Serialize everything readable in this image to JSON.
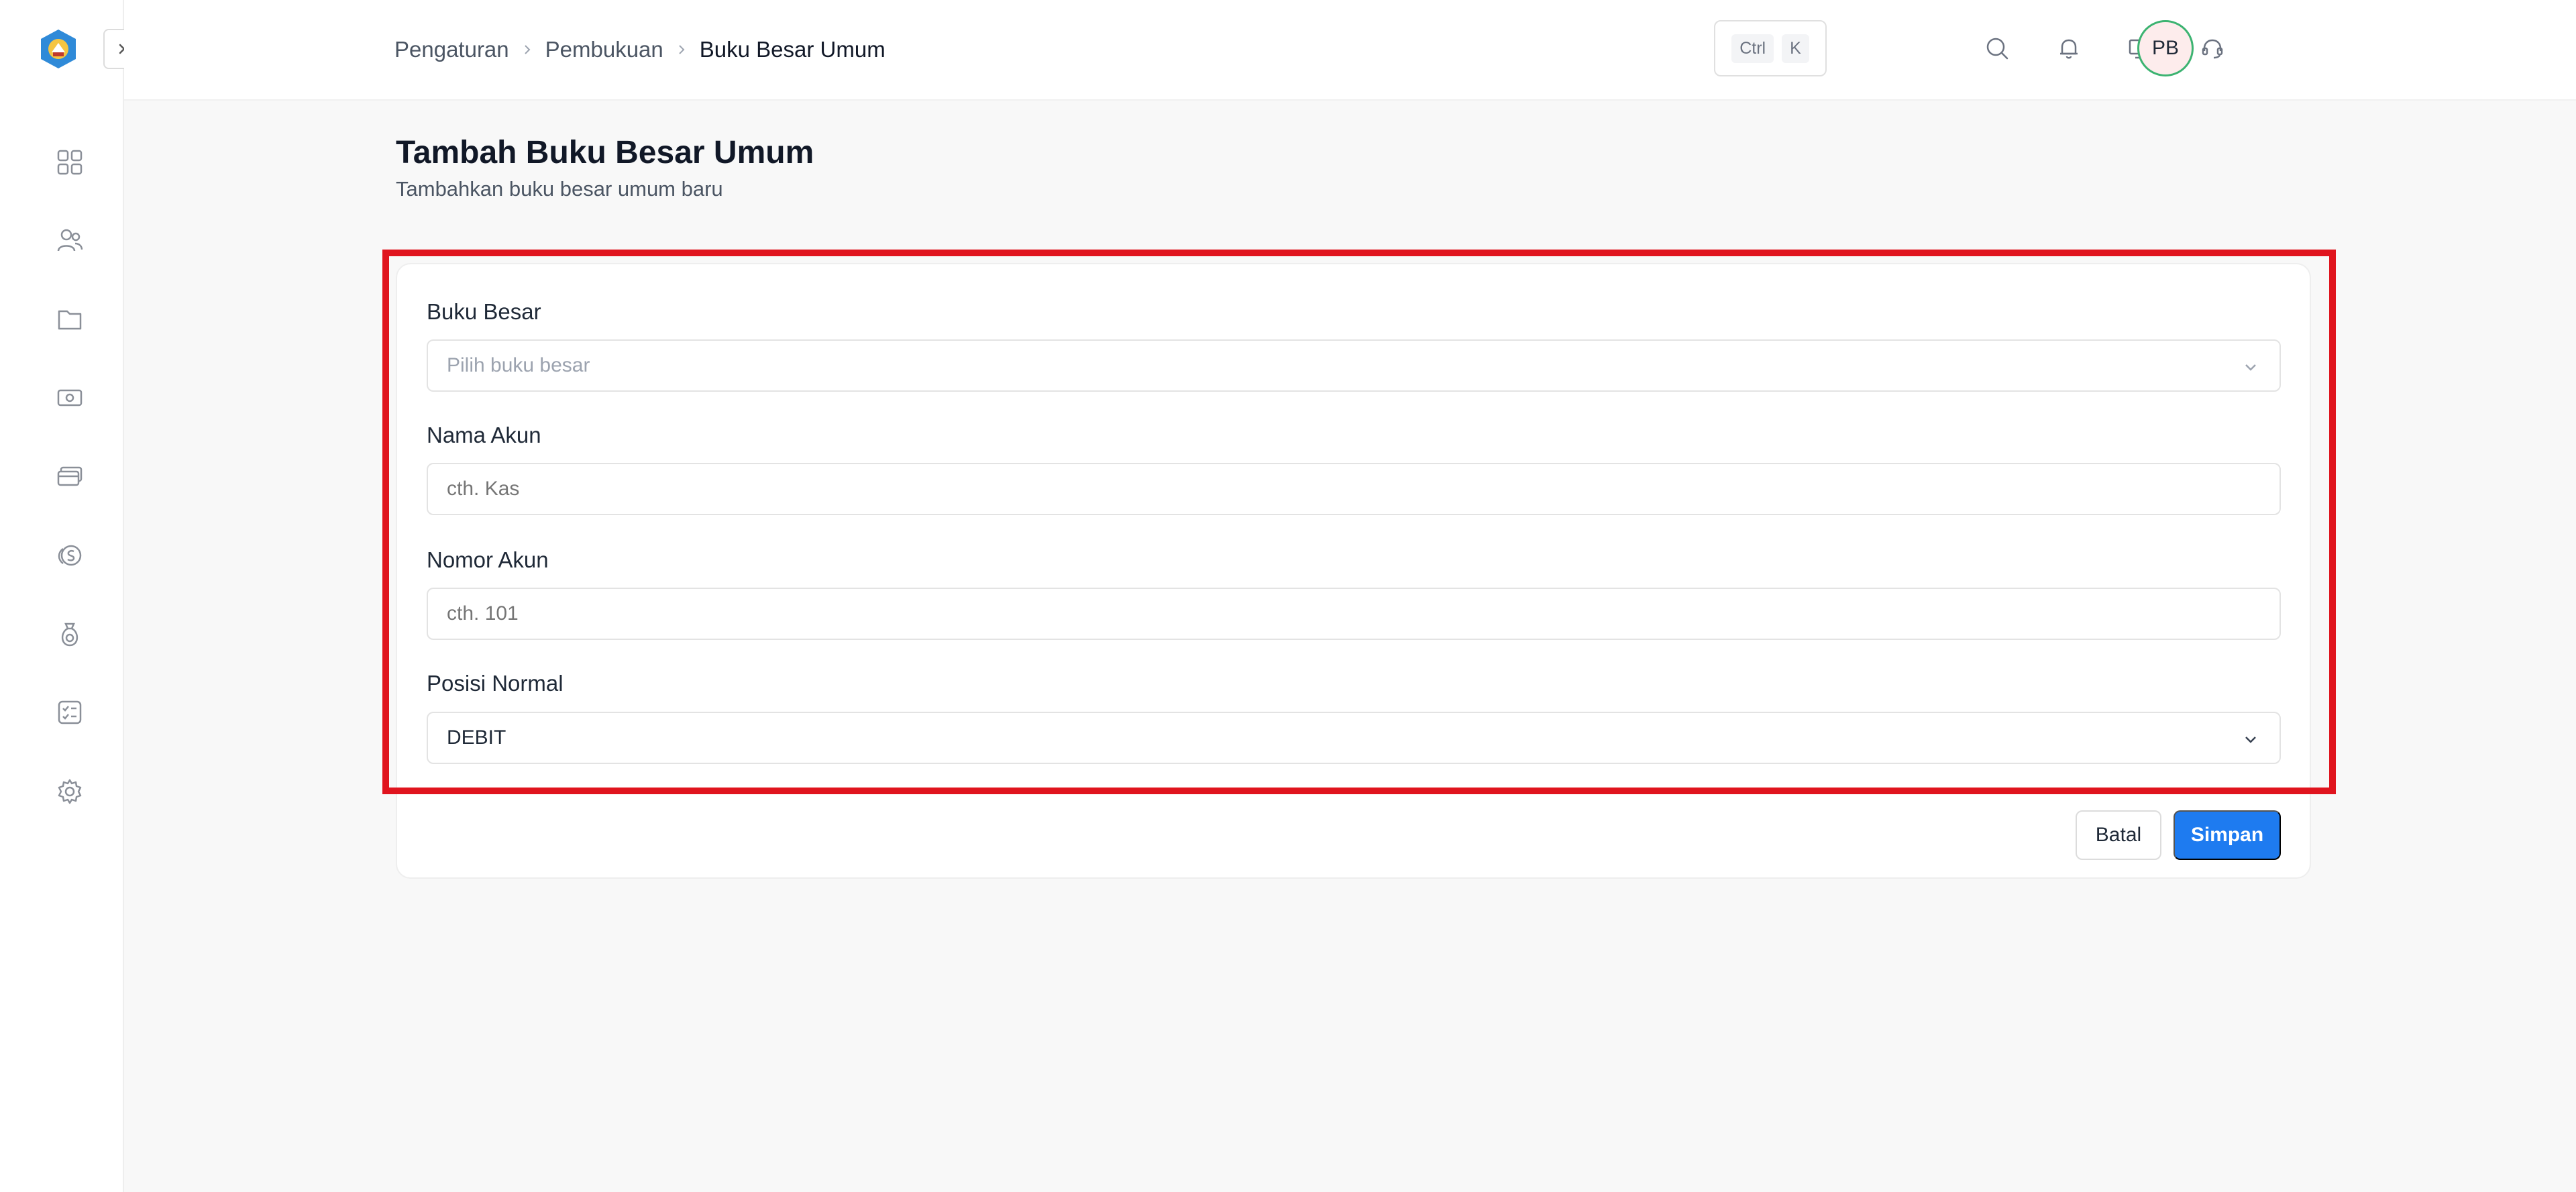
{
  "breadcrumb": [
    "Pengaturan",
    "Pembukuan",
    "Buku Besar Umum"
  ],
  "shortcut": {
    "key1": "Ctrl",
    "key2": "K"
  },
  "user": {
    "initials": "PB"
  },
  "page": {
    "title": "Tambah Buku Besar Umum",
    "subtitle": "Tambahkan buku besar umum baru"
  },
  "form": {
    "buku_besar": {
      "label": "Buku Besar",
      "placeholder": "Pilih buku besar"
    },
    "nama_akun": {
      "label": "Nama Akun",
      "placeholder": "cth. Kas"
    },
    "nomor_akun": {
      "label": "Nomor Akun",
      "placeholder": "cth. 101"
    },
    "posisi_normal": {
      "label": "Posisi Normal",
      "value": "DEBIT"
    }
  },
  "actions": {
    "cancel": "Batal",
    "save": "Simpan"
  },
  "colors": {
    "primary": "#1e7bf0",
    "highlight": "#e0141e",
    "avatar_ring": "#3cb371"
  }
}
